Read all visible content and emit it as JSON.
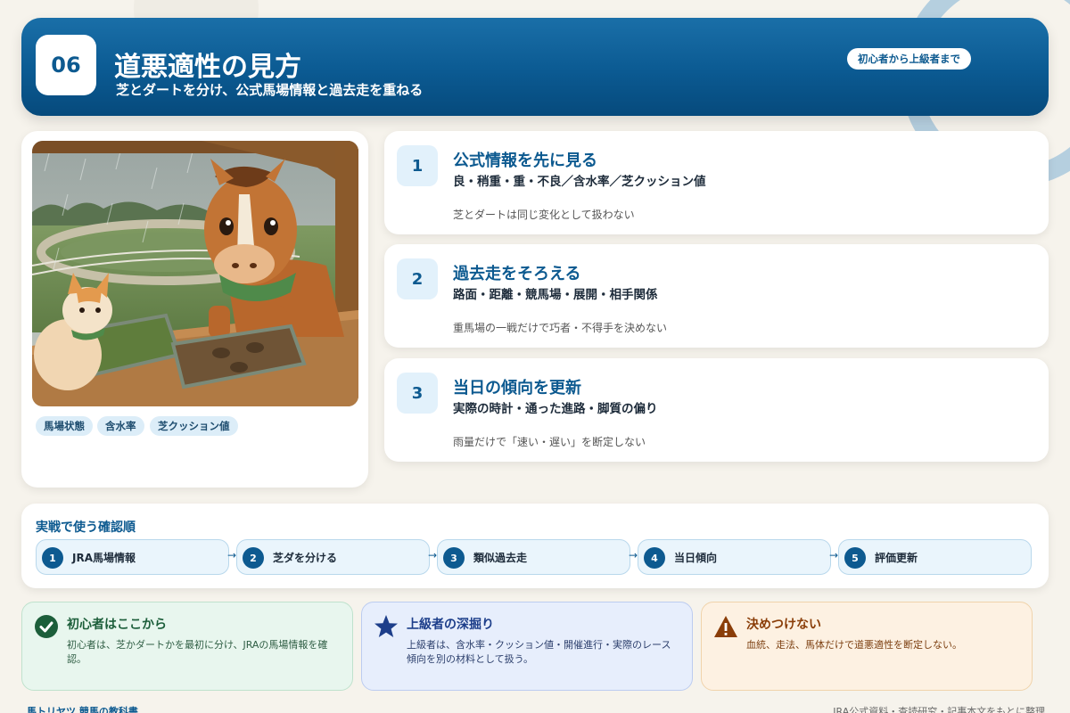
{
  "header": {
    "chapter_number": "06",
    "title": "道悪適性の見方",
    "subtitle": "芝とダートを分け、公式馬場情報と過去走を重ねる",
    "level_label": "初心者から上級者まで"
  },
  "illustration": {
    "tags": [
      "馬場状態",
      "含水率",
      "芝クッション値"
    ]
  },
  "steps": [
    {
      "number": "1",
      "title": "公式情報を先に見る",
      "detail": "良・稍重・重・不良／含水率／芝クッション値",
      "note": "芝とダートは同じ変化として扱わない"
    },
    {
      "number": "2",
      "title": "過去走をそろえる",
      "detail": "路面・距離・競馬場・展開・相手関係",
      "note": "重馬場の一戦だけで巧者・不得手を決めない"
    },
    {
      "number": "3",
      "title": "当日の傾向を更新",
      "detail": "実際の時計・通った進路・脚質の偏り",
      "note": "雨量だけで「速い・遅い」を断定しない"
    }
  ],
  "flow": {
    "title": "実戦で使う確認順",
    "steps": [
      {
        "number": "1",
        "label": "JRA馬場情報"
      },
      {
        "number": "2",
        "label": "芝ダを分ける"
      },
      {
        "number": "3",
        "label": "類似過去走"
      },
      {
        "number": "4",
        "label": "当日傾向"
      },
      {
        "number": "5",
        "label": "評価更新"
      }
    ],
    "arrow": "→"
  },
  "info_boxes": {
    "beginner": {
      "icon": "check-circle-icon",
      "title": "初心者はここから",
      "text": "初心者は、芝かダートかを最初に分け、JRAの馬場情報を確認。"
    },
    "advanced": {
      "icon": "star-icon",
      "title": "上級者の深掘り",
      "text": "上級者は、含水率・クッション値・開催進行・実際のレース傾向を別の材料として扱う。"
    },
    "caution": {
      "icon": "warning-icon",
      "title": "決めつけない",
      "text": "血統、走法、馬体だけで道悪適性を断定しない。"
    }
  },
  "footer": {
    "left": "馬トリヤツ 競馬の教科書",
    "right": "JRA公式資料・査読研究・記事本文をもとに整理"
  },
  "colors": {
    "primary": "#0d5a90",
    "header_gradient_top": "#1a6fa8",
    "header_gradient_bottom": "#064a7c",
    "background": "#f6f3ec",
    "green": "#1c5e3a",
    "blue": "#1d3e8a",
    "orange": "#8a3d08"
  }
}
